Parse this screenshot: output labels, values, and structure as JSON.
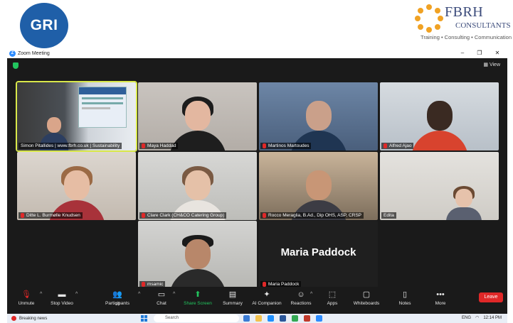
{
  "banner": {
    "gri_logo_text": "GRI",
    "fbrh_name": "FBRH",
    "fbrh_sub": "CONSULTANTS",
    "fbrh_tagline": "Training • Consulting • Communication"
  },
  "window": {
    "title": "Zoom Meeting",
    "view_label": "View",
    "minimize": "–",
    "restore": "❐",
    "close": "✕"
  },
  "tiles": [
    {
      "name": "Simon Pitallides | www.fbrh.co.uk | Sustainability",
      "muted": false,
      "active": true
    },
    {
      "name": "Maya Haddad",
      "muted": true,
      "active": false
    },
    {
      "name": "Martinos Martoudes",
      "muted": true,
      "active": false
    },
    {
      "name": "Alfred Ajao",
      "muted": true,
      "active": false
    },
    {
      "name": "Ditte L. Burmølle Knudsen",
      "muted": true,
      "active": false
    },
    {
      "name": "Clare Clark (CH&CO Catering Group)",
      "muted": true,
      "active": false
    },
    {
      "name": "Rocco Meraglia, B.Ad., Dip OHS, ASP, CRSP",
      "muted": true,
      "active": false
    },
    {
      "name": "Edita",
      "muted": false,
      "active": false
    },
    {
      "name": "msamic",
      "muted": true,
      "active": false
    },
    {
      "name": "Maria Paddock",
      "muted": true,
      "active": false,
      "big_name": "Maria Paddock"
    }
  ],
  "toolbar": {
    "unmute": "Unmute",
    "stop_video": "Stop Video",
    "participants": "Participants",
    "participants_count": "10",
    "chat": "Chat",
    "share_screen": "Share Screen",
    "summary": "Summary",
    "ai_companion": "AI Companion",
    "reactions": "Reactions",
    "apps": "Apps",
    "whiteboards": "Whiteboards",
    "notes": "Notes",
    "more": "More",
    "leave": "Leave"
  },
  "taskbar": {
    "news": "Breaking news",
    "search_placeholder": "Search",
    "lang": "ENG",
    "time": "12:14 PM"
  },
  "colors": {
    "zoom_bg": "#1a1a1a",
    "active_speaker": "#d9e84a",
    "leave_red": "#e02828",
    "share_green": "#22c55e",
    "gri_blue": "#1f5fa8",
    "fbrh_orange": "#f0a224"
  }
}
